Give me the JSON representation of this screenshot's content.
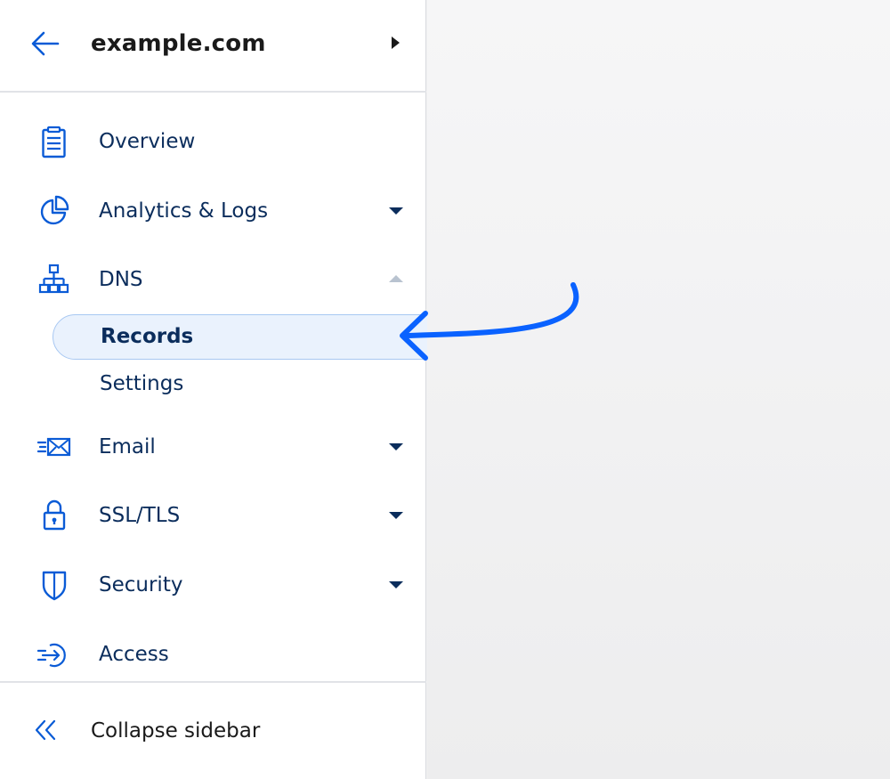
{
  "colors": {
    "accent": "#0a5bd6",
    "nav_text": "#0b2d5c",
    "active_bg": "#eaf2fd",
    "active_border": "#a8c8f2",
    "annotation_arrow": "#0a62ff"
  },
  "header": {
    "back_icon": "arrow-left-icon",
    "zone_name": "example.com",
    "zone_caret_icon": "caret-right-icon"
  },
  "nav": {
    "overview": {
      "label": "Overview",
      "icon": "clipboard-icon"
    },
    "analytics": {
      "label": "Analytics & Logs",
      "icon": "pie-chart-icon",
      "caret": "caret-down"
    },
    "dns": {
      "label": "DNS",
      "icon": "network-tree-icon",
      "caret": "caret-up",
      "sub": {
        "records": "Records",
        "settings": "Settings"
      }
    },
    "email": {
      "label": "Email",
      "icon": "envelope-fast-icon",
      "caret": "caret-down"
    },
    "ssl": {
      "label": "SSL/TLS",
      "icon": "lock-icon",
      "caret": "caret-down"
    },
    "security": {
      "label": "Security",
      "icon": "shield-icon",
      "caret": "caret-down"
    },
    "access": {
      "label": "Access",
      "icon": "access-signin-icon"
    }
  },
  "footer": {
    "collapse_label": "Collapse sidebar",
    "collapse_icon": "double-chevron-left-icon"
  }
}
